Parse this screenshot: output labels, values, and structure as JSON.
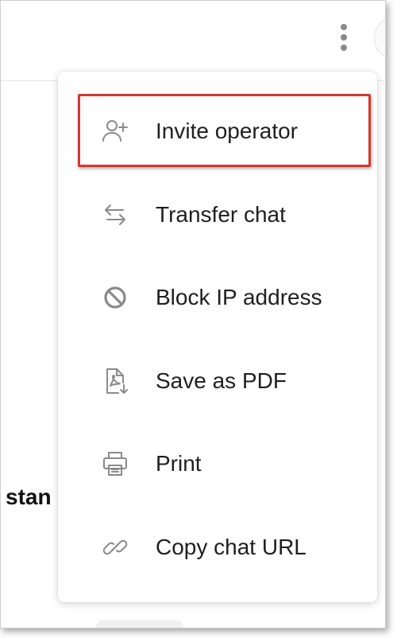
{
  "background": {
    "partial_text": "stan"
  },
  "header": {
    "more_options_icon": "kebab-vertical-icon"
  },
  "menu": {
    "items": [
      {
        "label": "Invite operator",
        "icon": "user-plus-icon"
      },
      {
        "label": "Transfer chat",
        "icon": "arrows-swap-icon"
      },
      {
        "label": "Block IP address",
        "icon": "block-icon"
      },
      {
        "label": "Save as PDF",
        "icon": "pdf-download-icon"
      },
      {
        "label": "Print",
        "icon": "printer-icon"
      },
      {
        "label": "Copy chat URL",
        "icon": "link-icon"
      }
    ]
  },
  "annotation": {
    "highlight_color": "#d23a2e"
  },
  "colors": {
    "icon": "#8a8a8a",
    "text": "#1f1f1f"
  }
}
